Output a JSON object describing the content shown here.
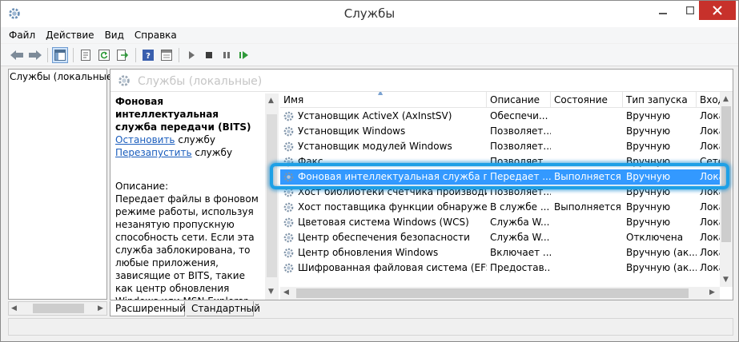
{
  "window": {
    "title": "Службы"
  },
  "menu": [
    "Файл",
    "Действие",
    "Вид",
    "Справка"
  ],
  "tree": {
    "root": "Службы (локальные)"
  },
  "main_header": {
    "title": "Службы (локальные)"
  },
  "details": {
    "service_title": "Фоновая интеллектуальная служба передачи (BITS)",
    "stop_link": "Остановить",
    "stop_suffix": " службу",
    "restart_link": "Перезапустить",
    "restart_suffix": " службу",
    "description_label": "Описание:",
    "description_text": "Передает файлы в фоновом режиме работы, используя незанятую пропускную способность сети. Если эта служба заблокирована, то любые приложения, зависящие от BITS, такие как центр обновления Windows или MSN Explorer, не смогут"
  },
  "columns": {
    "name": "Имя",
    "description": "Описание",
    "state": "Состояние",
    "startup": "Тип запуска",
    "login": "Вход"
  },
  "services": [
    {
      "name": "Установщик ActiveX (AxInstSV)",
      "description": "Обеспечи...",
      "state": "",
      "startup": "Вручную",
      "login": "Лока"
    },
    {
      "name": "Установщик Windows",
      "description": "Позволяет...",
      "state": "",
      "startup": "Вручную",
      "login": "Лока"
    },
    {
      "name": "Установщик модулей Windows",
      "description": "Позволяет...",
      "state": "",
      "startup": "Вручную",
      "login": "Лока"
    },
    {
      "name": "Факс",
      "description": "Позволяет...",
      "state": "",
      "startup": "Вручную",
      "login": "Сете"
    },
    {
      "name": "Фоновая интеллектуальная служба пер...",
      "description": "Передает ...",
      "state": "Выполняется",
      "startup": "Вручную",
      "login": "Лока"
    },
    {
      "name": "Хост библиотеки счетчика производите...",
      "description": "Позволяет...",
      "state": "",
      "startup": "Вручную",
      "login": "Лока"
    },
    {
      "name": "Хост поставщика функции обнаружения",
      "description": "В службе ...",
      "state": "Выполняется",
      "startup": "Вручную",
      "login": "Лока"
    },
    {
      "name": "Цветовая система Windows (WCS)",
      "description": "Служба W...",
      "state": "",
      "startup": "Вручную",
      "login": "Лока"
    },
    {
      "name": "Центр обеспечения безопасности",
      "description": "Служба W...",
      "state": "",
      "startup": "Отключена",
      "login": "Лока"
    },
    {
      "name": "Центр обновления Windows",
      "description": "Включает ...",
      "state": "",
      "startup": "Вручную (ак...",
      "login": "Лока"
    },
    {
      "name": "Шифрованная файловая система (EFS)",
      "description": "Предостав...",
      "state": "",
      "startup": "Вручную (ак...",
      "login": "Лока"
    }
  ],
  "selected_index": 4,
  "tabs": {
    "extended": "Расширенный",
    "standard": "Стандартный"
  },
  "colors": {
    "selection": "#3399ff",
    "highlight_frame": "#1ea0e6",
    "link": "#1a5dbd",
    "close_button": "#c7312b"
  }
}
